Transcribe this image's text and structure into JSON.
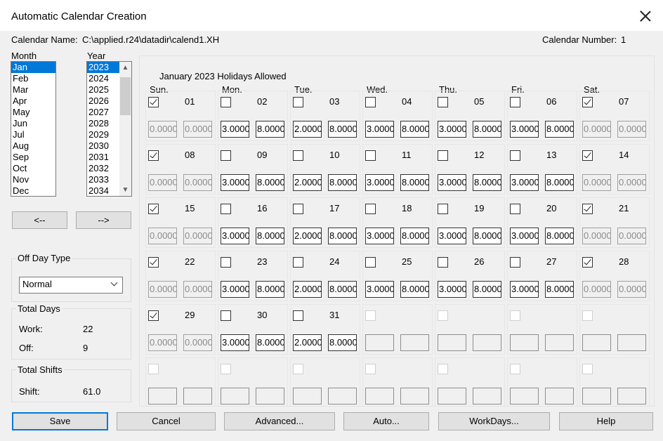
{
  "window": {
    "title": "Automatic Calendar Creation"
  },
  "info": {
    "calendar_name_label": "Calendar Name:",
    "calendar_name_value": "C:\\applied.r24\\datadir\\calend1.XH",
    "calendar_number_label": "Calendar Number:",
    "calendar_number_value": "1"
  },
  "month": {
    "label": "Month",
    "items": [
      "Jan",
      "Feb",
      "Mar",
      "Apr",
      "May",
      "Jun",
      "Jul",
      "Aug",
      "Sep",
      "Oct",
      "Nov",
      "Dec"
    ],
    "selected": "Jan"
  },
  "year": {
    "label": "Year",
    "items": [
      "2023",
      "2024",
      "2025",
      "2026",
      "2027",
      "2028",
      "2029",
      "2030",
      "2031",
      "2032",
      "2033",
      "2034"
    ],
    "selected": "2023"
  },
  "nav": {
    "prev_label": "<--",
    "next_label": "-->"
  },
  "off_day_type": {
    "label": "Off Day Type",
    "value": "Normal"
  },
  "total_days": {
    "label": "Total Days",
    "work_label": "Work:",
    "work_value": "22",
    "off_label": "Off:",
    "off_value": "9"
  },
  "total_shifts": {
    "label": "Total Shifts",
    "shift_label": "Shift:",
    "shift_value": "61.0"
  },
  "calendar": {
    "heading": "January 2023 Holidays Allowed",
    "weekdays": [
      "Sun.",
      "Mon.",
      "Tue.",
      "Wed.",
      "Thu.",
      "Fri.",
      "Sat."
    ],
    "weeks": [
      [
        {
          "day": "01",
          "checked": true,
          "v1": "0.0000",
          "v2": "0.0000"
        },
        {
          "day": "02",
          "checked": false,
          "v1": "3.0000",
          "v2": "8.0000"
        },
        {
          "day": "03",
          "checked": false,
          "v1": "2.0000",
          "v2": "8.0000"
        },
        {
          "day": "04",
          "checked": false,
          "v1": "3.0000",
          "v2": "8.0000"
        },
        {
          "day": "05",
          "checked": false,
          "v1": "3.0000",
          "v2": "8.0000"
        },
        {
          "day": "06",
          "checked": false,
          "v1": "3.0000",
          "v2": "8.0000"
        },
        {
          "day": "07",
          "checked": true,
          "v1": "0.0000",
          "v2": "0.0000"
        }
      ],
      [
        {
          "day": "08",
          "checked": true,
          "v1": "0.0000",
          "v2": "0.0000"
        },
        {
          "day": "09",
          "checked": false,
          "v1": "3.0000",
          "v2": "8.0000"
        },
        {
          "day": "10",
          "checked": false,
          "v1": "2.0000",
          "v2": "8.0000"
        },
        {
          "day": "11",
          "checked": false,
          "v1": "3.0000",
          "v2": "8.0000"
        },
        {
          "day": "12",
          "checked": false,
          "v1": "3.0000",
          "v2": "8.0000"
        },
        {
          "day": "13",
          "checked": false,
          "v1": "3.0000",
          "v2": "8.0000"
        },
        {
          "day": "14",
          "checked": true,
          "v1": "0.0000",
          "v2": "0.0000"
        }
      ],
      [
        {
          "day": "15",
          "checked": true,
          "v1": "0.0000",
          "v2": "0.0000"
        },
        {
          "day": "16",
          "checked": false,
          "v1": "3.0000",
          "v2": "8.0000"
        },
        {
          "day": "17",
          "checked": false,
          "v1": "2.0000",
          "v2": "8.0000"
        },
        {
          "day": "18",
          "checked": false,
          "v1": "3.0000",
          "v2": "8.0000"
        },
        {
          "day": "19",
          "checked": false,
          "v1": "3.0000",
          "v2": "8.0000"
        },
        {
          "day": "20",
          "checked": false,
          "v1": "3.0000",
          "v2": "8.0000"
        },
        {
          "day": "21",
          "checked": true,
          "v1": "0.0000",
          "v2": "0.0000"
        }
      ],
      [
        {
          "day": "22",
          "checked": true,
          "v1": "0.0000",
          "v2": "0.0000"
        },
        {
          "day": "23",
          "checked": false,
          "v1": "3.0000",
          "v2": "8.0000"
        },
        {
          "day": "24",
          "checked": false,
          "v1": "2.0000",
          "v2": "8.0000"
        },
        {
          "day": "25",
          "checked": false,
          "v1": "3.0000",
          "v2": "8.0000"
        },
        {
          "day": "26",
          "checked": false,
          "v1": "3.0000",
          "v2": "8.0000"
        },
        {
          "day": "27",
          "checked": false,
          "v1": "3.0000",
          "v2": "8.0000"
        },
        {
          "day": "28",
          "checked": true,
          "v1": "0.0000",
          "v2": "0.0000"
        }
      ],
      [
        {
          "day": "29",
          "checked": true,
          "v1": "0.0000",
          "v2": "0.0000"
        },
        {
          "day": "30",
          "checked": false,
          "v1": "3.0000",
          "v2": "8.0000"
        },
        {
          "day": "31",
          "checked": false,
          "v1": "2.0000",
          "v2": "8.0000"
        },
        {
          "day": "",
          "empty": true
        },
        {
          "day": "",
          "empty": true
        },
        {
          "day": "",
          "empty": true
        },
        {
          "day": "",
          "empty": true
        }
      ],
      [
        {
          "day": "",
          "empty": true
        },
        {
          "day": "",
          "empty": true
        },
        {
          "day": "",
          "empty": true
        },
        {
          "day": "",
          "empty": true
        },
        {
          "day": "",
          "empty": true
        },
        {
          "day": "",
          "empty": true
        },
        {
          "day": "",
          "empty": true
        }
      ]
    ]
  },
  "footer": {
    "save_label": "Save",
    "cancel_label": "Cancel",
    "advanced_label": "Advanced...",
    "auto_label": "Auto...",
    "workdays_label": "WorkDays...",
    "help_label": "Help"
  }
}
